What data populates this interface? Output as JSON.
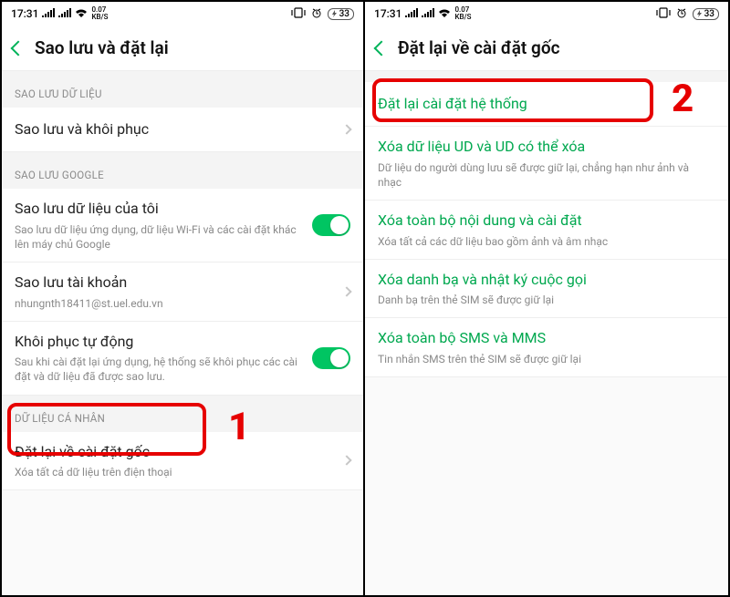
{
  "status": {
    "time": "17:31",
    "speed_top": "0.07",
    "speed_bot": "KB/S",
    "battery": "33"
  },
  "left": {
    "title": "Sao lưu và đặt lại",
    "sec1": "SAO LƯU DỮ LIỆU",
    "r1": "Sao lưu và khôi phục",
    "sec2": "SAO LƯU GOOGLE",
    "r2t": "Sao lưu dữ liệu của tôi",
    "r2s": "Sao lưu dữ liệu ứng dụng, dữ liệu Wi-Fi và các cài đặt khác lên máy chủ Google",
    "r3t": "Sao lưu tài khoản",
    "r3s": "nhungnth18411@st.uel.edu.vn",
    "r4t": "Khôi phục tự động",
    "r4s": "Sau khi cài đặt lại ứng dụng, hệ thống sẽ khôi phục các cài đặt và dữ liệu đã được sao lưu.",
    "sec3": "DỮ LIỆU CÁ NHÂN",
    "r5t": "Đặt lại về cài đặt gốc",
    "r5s": "Xóa tất cả dữ liệu trên điện thoại",
    "marker1": "1"
  },
  "right": {
    "title": "Đặt lại về cài đặt gốc",
    "r1": "Đặt lại cài đặt hệ thống",
    "r2t": "Xóa dữ liệu UD và UD có thể xóa",
    "r2s": "Dữ liệu do người dùng lưu sẽ được giữ lại, chẳng hạn như ảnh và nhạc",
    "r3t": "Xóa toàn bộ nội dung và cài đặt",
    "r3s": "Xóa tất cả các dữ liệu bao gồm ảnh và âm nhạc",
    "r4t": "Xóa danh bạ và nhật ký cuộc gọi",
    "r4s": "Danh bạ trên thẻ SIM sẽ được giữ lại",
    "r5t": "Xóa toàn bộ SMS và MMS",
    "r5s": "Tin nhắn SMS trên thẻ SIM sẽ được giữ lại",
    "marker2": "2"
  }
}
